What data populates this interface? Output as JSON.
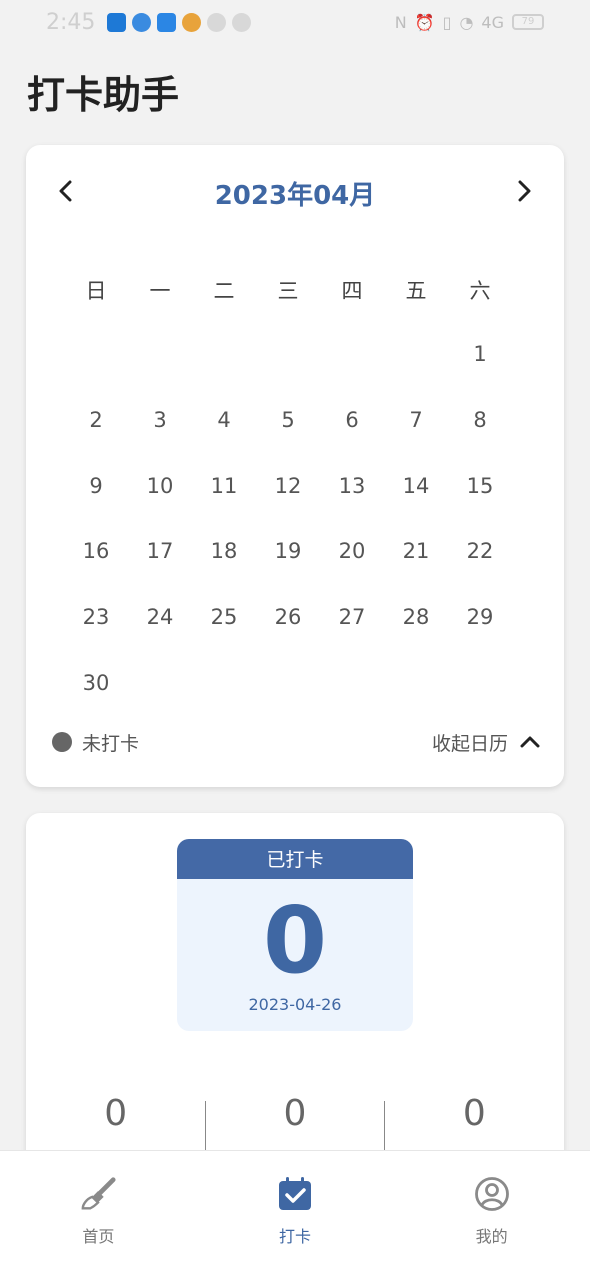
{
  "status_bar": {
    "time": "2:45",
    "battery": "79",
    "signal_text": "4G"
  },
  "page": {
    "title": "打卡助手"
  },
  "calendar": {
    "month_label": "2023年04月",
    "weekdays": [
      "日",
      "一",
      "二",
      "三",
      "四",
      "五",
      "六"
    ],
    "weeks": [
      [
        "",
        "",
        "",
        "",
        "",
        "",
        "1"
      ],
      [
        "2",
        "3",
        "4",
        "5",
        "6",
        "7",
        "8"
      ],
      [
        "9",
        "10",
        "11",
        "12",
        "13",
        "14",
        "15"
      ],
      [
        "16",
        "17",
        "18",
        "19",
        "20",
        "21",
        "22"
      ],
      [
        "23",
        "24",
        "25",
        "26",
        "27",
        "28",
        "29"
      ],
      [
        "30",
        "",
        "",
        "",
        "",
        "",
        ""
      ]
    ],
    "legend_label": "未打卡",
    "collapse_label": "收起日历"
  },
  "checkin": {
    "header": "已打卡",
    "count": "0",
    "date": "2023-04-26"
  },
  "stats": [
    "0",
    "0",
    "0"
  ],
  "tabbar": {
    "items": [
      {
        "label": "首页",
        "icon": "brush-icon"
      },
      {
        "label": "打卡",
        "icon": "calendar-check-icon"
      },
      {
        "label": "我的",
        "icon": "user-icon"
      }
    ],
    "active_color": "#3f67a3"
  }
}
